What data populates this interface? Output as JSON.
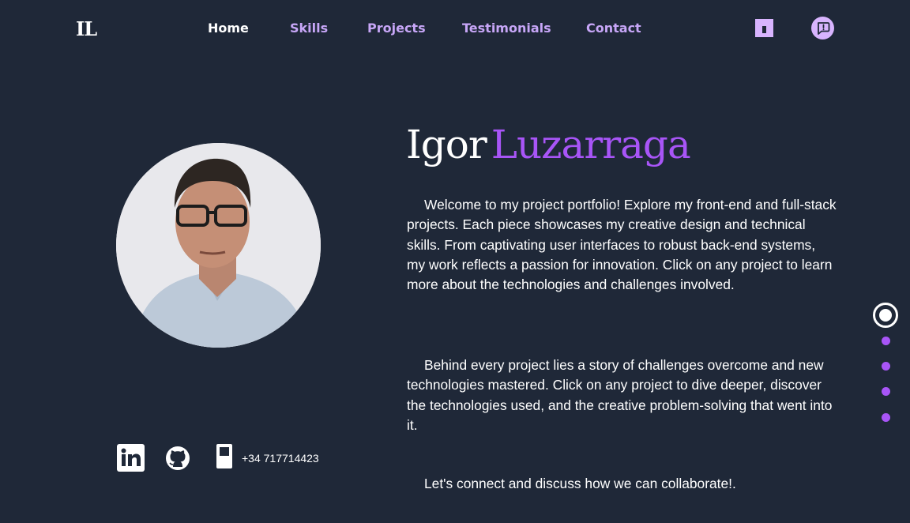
{
  "header": {
    "logo": "IL",
    "nav": [
      {
        "label": "Home",
        "active": true
      },
      {
        "label": "Skills"
      },
      {
        "label": "Projects"
      },
      {
        "label": "Testimonials"
      },
      {
        "label": "Contact"
      }
    ],
    "icons": [
      "flipboard-icon",
      "chat-icon"
    ]
  },
  "hero": {
    "first_name": "Igor",
    "last_name": "Luzarraga",
    "paragraphs": [
      "Welcome to my project portfolio! Explore my front-end and full-stack projects. Each piece showcases my creative design and technical skills. From captivating user interfaces to robust back-end systems, my work reflects a passion for innovation. Click on any project to learn more about the technologies and challenges involved.",
      "Behind every project lies a story of challenges overcome and new technologies mastered. Click on any project to dive deeper, discover the technologies used, and the creative problem-solving that went into it.",
      "Let's connect and discuss how we can collaborate!."
    ]
  },
  "social": {
    "icons": [
      "linkedin-icon",
      "github-icon",
      "phone-icon"
    ],
    "phone": "+34 717714423"
  },
  "section_dots": {
    "count": 5,
    "active_index": 0
  },
  "colors": {
    "background": "#1f2838",
    "accent": "#a855f7",
    "nav_link": "#c7a6f7",
    "text": "#ffffff"
  }
}
